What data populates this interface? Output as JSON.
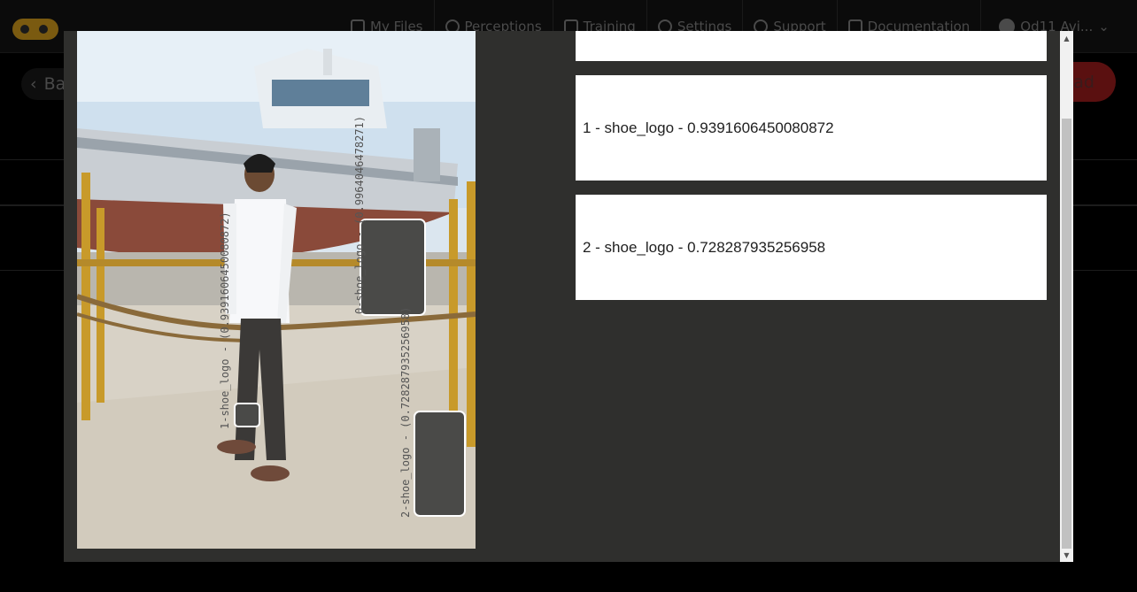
{
  "nav": {
    "items": [
      {
        "label": "My Files",
        "icon": "file-arrow-icon"
      },
      {
        "label": "Perceptions",
        "icon": "eye-icon"
      },
      {
        "label": "Training",
        "icon": "book-icon"
      },
      {
        "label": "Settings",
        "icon": "gear-icon"
      },
      {
        "label": "Support",
        "icon": "info-icon"
      },
      {
        "label": "Documentation",
        "icon": "documents-icon"
      }
    ],
    "user": "Od11 Avi...",
    "user_caret": "⌄"
  },
  "page": {
    "back_label": "Ba",
    "back_chevron": "‹",
    "upload_label": "ad"
  },
  "modal": {
    "results": [
      {
        "text": "1 - shoe_logo - 0.9391606450080872"
      },
      {
        "text": "2 - shoe_logo - 0.728287935256958"
      }
    ],
    "image_labels": [
      "0-shoe_logo - (0.9964046478271)",
      "1-shoe_logo - (0.9391606450080872)",
      "2-shoe_logo - (0.728287935256958)"
    ],
    "scroll_up": "▲",
    "scroll_down": "▼"
  },
  "colors": {
    "modal_bg": "#2f2f2d",
    "card_bg": "#ffffff",
    "upload_accent": "#b32020"
  }
}
